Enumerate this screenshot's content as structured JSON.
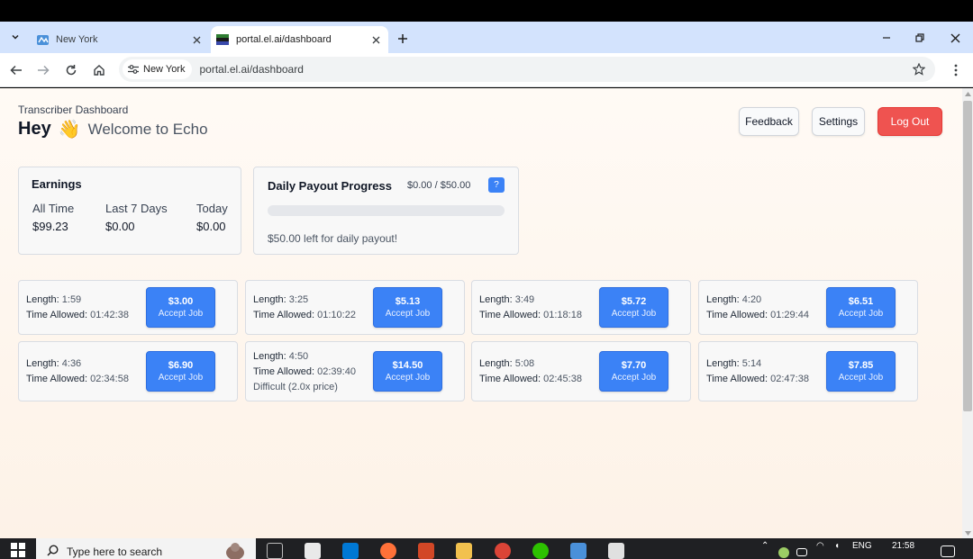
{
  "browser": {
    "tabs": [
      {
        "title": "New York",
        "active": false
      },
      {
        "title": "portal.el.ai/dashboard",
        "active": true
      }
    ],
    "site_chip": "New York",
    "url": "portal.el.ai/dashboard"
  },
  "header": {
    "subtitle": "Transcriber Dashboard",
    "hey": "Hey",
    "wave_emoji": "👋",
    "welcome": "Welcome to Echo",
    "buttons": {
      "feedback": "Feedback",
      "settings": "Settings",
      "logout": "Log Out"
    }
  },
  "earnings": {
    "title": "Earnings",
    "columns": [
      {
        "label": "All Time",
        "value": "$99.23"
      },
      {
        "label": "Last 7 Days",
        "value": "$0.00"
      },
      {
        "label": "Today",
        "value": "$0.00"
      }
    ]
  },
  "payout": {
    "title": "Daily Payout Progress",
    "amount": "$0.00 / $50.00",
    "help": "?",
    "progress_fraction": 0,
    "left_text": "$50.00 left for daily payout!"
  },
  "jobs": {
    "length_label": "Length:",
    "time_label": "Time Allowed:",
    "accept_label": "Accept Job",
    "items": [
      {
        "length": "1:59",
        "time_allowed": "01:42:38",
        "price": "$3.00",
        "note": ""
      },
      {
        "length": "3:25",
        "time_allowed": "01:10:22",
        "price": "$5.13",
        "note": ""
      },
      {
        "length": "3:49",
        "time_allowed": "01:18:18",
        "price": "$5.72",
        "note": ""
      },
      {
        "length": "4:20",
        "time_allowed": "01:29:44",
        "price": "$6.51",
        "note": ""
      },
      {
        "length": "4:36",
        "time_allowed": "02:34:58",
        "price": "$6.90",
        "note": ""
      },
      {
        "length": "4:50",
        "time_allowed": "02:39:40",
        "price": "$14.50",
        "note": "Difficult (2.0x price)"
      },
      {
        "length": "5:08",
        "time_allowed": "02:45:38",
        "price": "$7.70",
        "note": ""
      },
      {
        "length": "5:14",
        "time_allowed": "02:47:38",
        "price": "$7.85",
        "note": ""
      }
    ]
  },
  "taskbar": {
    "search_placeholder": "Type here to search",
    "language": "ENG",
    "time": "21:58"
  }
}
